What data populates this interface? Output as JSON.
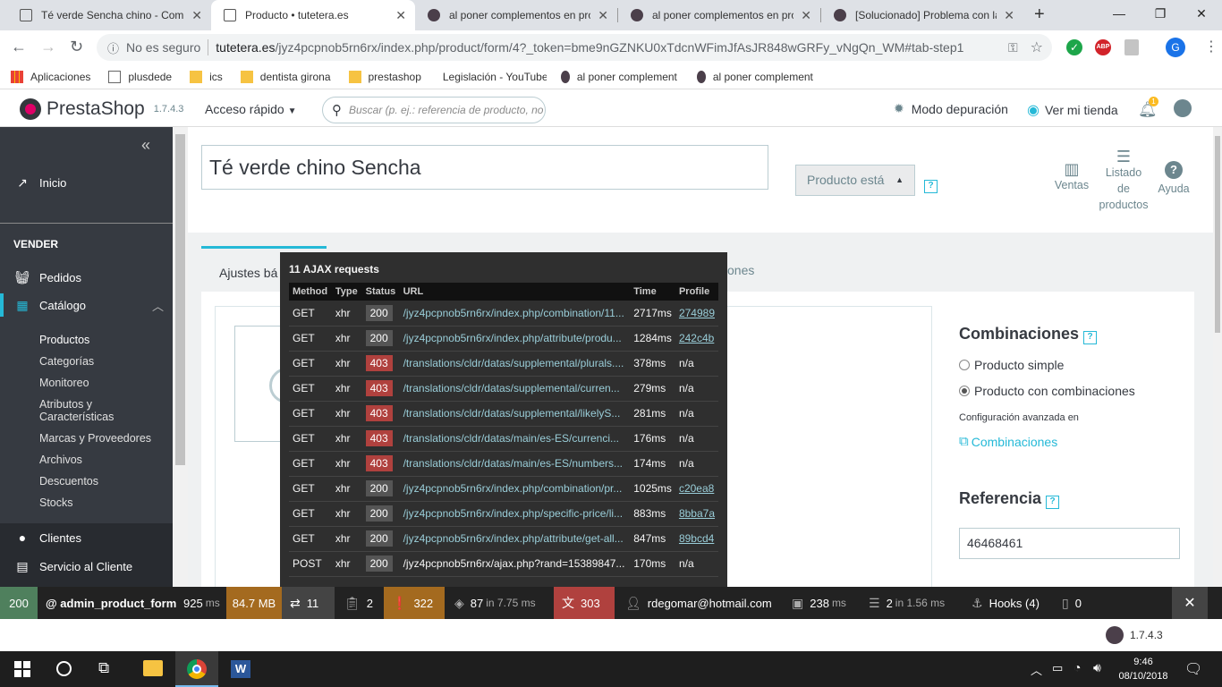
{
  "browser": {
    "tabs": [
      {
        "title": "Té verde Sencha chino - Comp",
        "active": false
      },
      {
        "title": "Producto • tutetera.es",
        "active": true
      },
      {
        "title": "al poner complementos en pro",
        "active": false
      },
      {
        "title": "al poner complementos en pro",
        "active": false
      },
      {
        "title": "[Solucionado] Problema con la",
        "active": false
      }
    ],
    "new_tab": "+",
    "url_security": "No es seguro",
    "url_host": "tutetera.es",
    "url_path": "/jyz4pcpnob5rn6rx/index.php/product/form/4?_token=bme9nGZNKU0xTdcnWFimJfAsJR848wGRFy_vNgQn_WM#tab-step1",
    "profile_initial": "G",
    "bookmarks": [
      "Aplicaciones",
      "plusdede",
      "ics",
      "dentista girona",
      "prestashop",
      "Legislación - YouTube",
      "al poner complement",
      "al poner complement"
    ]
  },
  "ps_header": {
    "brand": "PrestaShop",
    "version": "1.7.4.3",
    "quick_access": "Acceso rápido",
    "search_placeholder": "Buscar (p. ej.: referencia de producto, no",
    "debug_mode": "Modo depuración",
    "view_store": "Ver mi tienda",
    "notif_count": "1"
  },
  "sidebar": {
    "collapse": "«",
    "home": "Inicio",
    "section": "VENDER",
    "orders": "Pedidos",
    "catalog": "Catálogo",
    "catalog_sub": [
      "Productos",
      "Categorías",
      "Monitoreo",
      "Atributos y Características",
      "Marcas y Proveedores",
      "Archivos",
      "Descuentos",
      "Stocks"
    ],
    "customers": "Clientes",
    "service": "Servicio al Cliente"
  },
  "product": {
    "name": "Té verde chino Sencha",
    "status_select": "Producto está",
    "help": "?",
    "actions": {
      "sales": "Ventas",
      "list_l1": "Listado",
      "list_l2": "de",
      "list_l3": "productos",
      "help": "Ayuda"
    },
    "tab_basic": "Ajustes bá",
    "tab_partial": "ones",
    "combinations_title": "Combinaciones",
    "simple_product": "Producto simple",
    "combo_product": "Producto con combinaciones",
    "advanced_config": "Configuración avanzada en",
    "combinations_link": "Combinaciones",
    "reference_title": "Referencia",
    "reference_value": "46468461"
  },
  "ajax_panel": {
    "title": "11 AJAX requests",
    "headers": [
      "Method",
      "Type",
      "Status",
      "URL",
      "Time",
      "Profile"
    ],
    "rows": [
      {
        "method": "GET",
        "type": "xhr",
        "status": "200",
        "url": "/jyz4pcpnob5rn6rx/index.php/combination/11...",
        "time": "2717ms",
        "profile": "274989"
      },
      {
        "method": "GET",
        "type": "xhr",
        "status": "200",
        "url": "/jyz4pcpnob5rn6rx/index.php/attribute/produ...",
        "time": "1284ms",
        "profile": "242c4b"
      },
      {
        "method": "GET",
        "type": "xhr",
        "status": "403",
        "url": "/translations/cldr/datas/supplemental/plurals....",
        "time": "378ms",
        "profile": "n/a"
      },
      {
        "method": "GET",
        "type": "xhr",
        "status": "403",
        "url": "/translations/cldr/datas/supplemental/curren...",
        "time": "279ms",
        "profile": "n/a"
      },
      {
        "method": "GET",
        "type": "xhr",
        "status": "403",
        "url": "/translations/cldr/datas/supplemental/likelyS...",
        "time": "281ms",
        "profile": "n/a"
      },
      {
        "method": "GET",
        "type": "xhr",
        "status": "403",
        "url": "/translations/cldr/datas/main/es-ES/currenci...",
        "time": "176ms",
        "profile": "n/a"
      },
      {
        "method": "GET",
        "type": "xhr",
        "status": "403",
        "url": "/translations/cldr/datas/main/es-ES/numbers...",
        "time": "174ms",
        "profile": "n/a"
      },
      {
        "method": "GET",
        "type": "xhr",
        "status": "200",
        "url": "/jyz4pcpnob5rn6rx/index.php/combination/pr...",
        "time": "1025ms",
        "profile": "c20ea8"
      },
      {
        "method": "GET",
        "type": "xhr",
        "status": "200",
        "url": "/jyz4pcpnob5rn6rx/index.php/specific-price/li...",
        "time": "883ms",
        "profile": "8bba7a"
      },
      {
        "method": "GET",
        "type": "xhr",
        "status": "200",
        "url": "/jyz4pcpnob5rn6rx/index.php/attribute/get-all...",
        "time": "847ms",
        "profile": "89bcd4"
      },
      {
        "method": "POST",
        "type": "xhr",
        "status": "200",
        "url": "/jyz4pcpnob5rn6rx/ajax.php?rand=15389847...",
        "time": "170ms",
        "profile": "n/a"
      }
    ]
  },
  "sf_toolbar": {
    "status": "200",
    "route": "@ admin_product_form",
    "time": "925",
    "time_unit": "ms",
    "memory": "84.7 MB",
    "ajax": "11",
    "forms": "2",
    "logs": "322",
    "cache": "87",
    "cache_in": "in 7.75 ms",
    "translations": "303",
    "user": "rdegomar@hotmail.com",
    "twig": "238",
    "twig_unit": "ms",
    "db": "2",
    "db_in": "in 1.56 ms",
    "hooks": "Hooks (4)",
    "modules": "0",
    "close": "✕",
    "mini_version": "1.7.4.3"
  },
  "taskbar": {
    "time": "9:46",
    "date": "08/10/2018"
  }
}
